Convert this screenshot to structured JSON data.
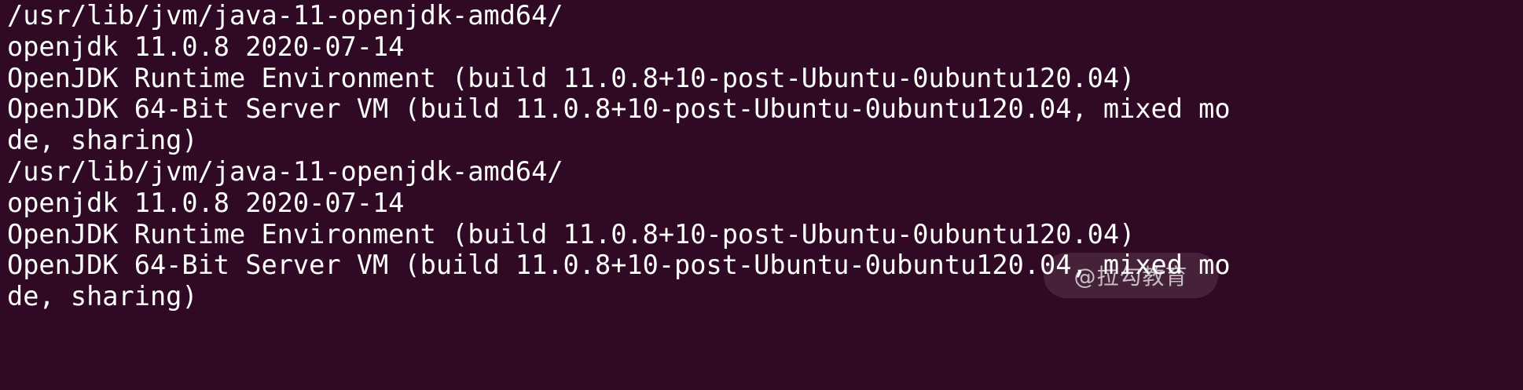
{
  "terminal": {
    "background": "#300a24",
    "foreground": "#ffffff",
    "lines": [
      "/usr/lib/jvm/java-11-openjdk-amd64/",
      "openjdk 11.0.8 2020-07-14",
      "OpenJDK Runtime Environment (build 11.0.8+10-post-Ubuntu-0ubuntu120.04)",
      "OpenJDK 64-Bit Server VM (build 11.0.8+10-post-Ubuntu-0ubuntu120.04, mixed mo",
      "de, sharing)",
      "/usr/lib/jvm/java-11-openjdk-amd64/",
      "openjdk 11.0.8 2020-07-14",
      "OpenJDK Runtime Environment (build 11.0.8+10-post-Ubuntu-0ubuntu120.04)",
      "OpenJDK 64-Bit Server VM (build 11.0.8+10-post-Ubuntu-0ubuntu120.04, mixed mo",
      "de, sharing)"
    ]
  },
  "watermark": {
    "text": "@拉勾教育"
  }
}
